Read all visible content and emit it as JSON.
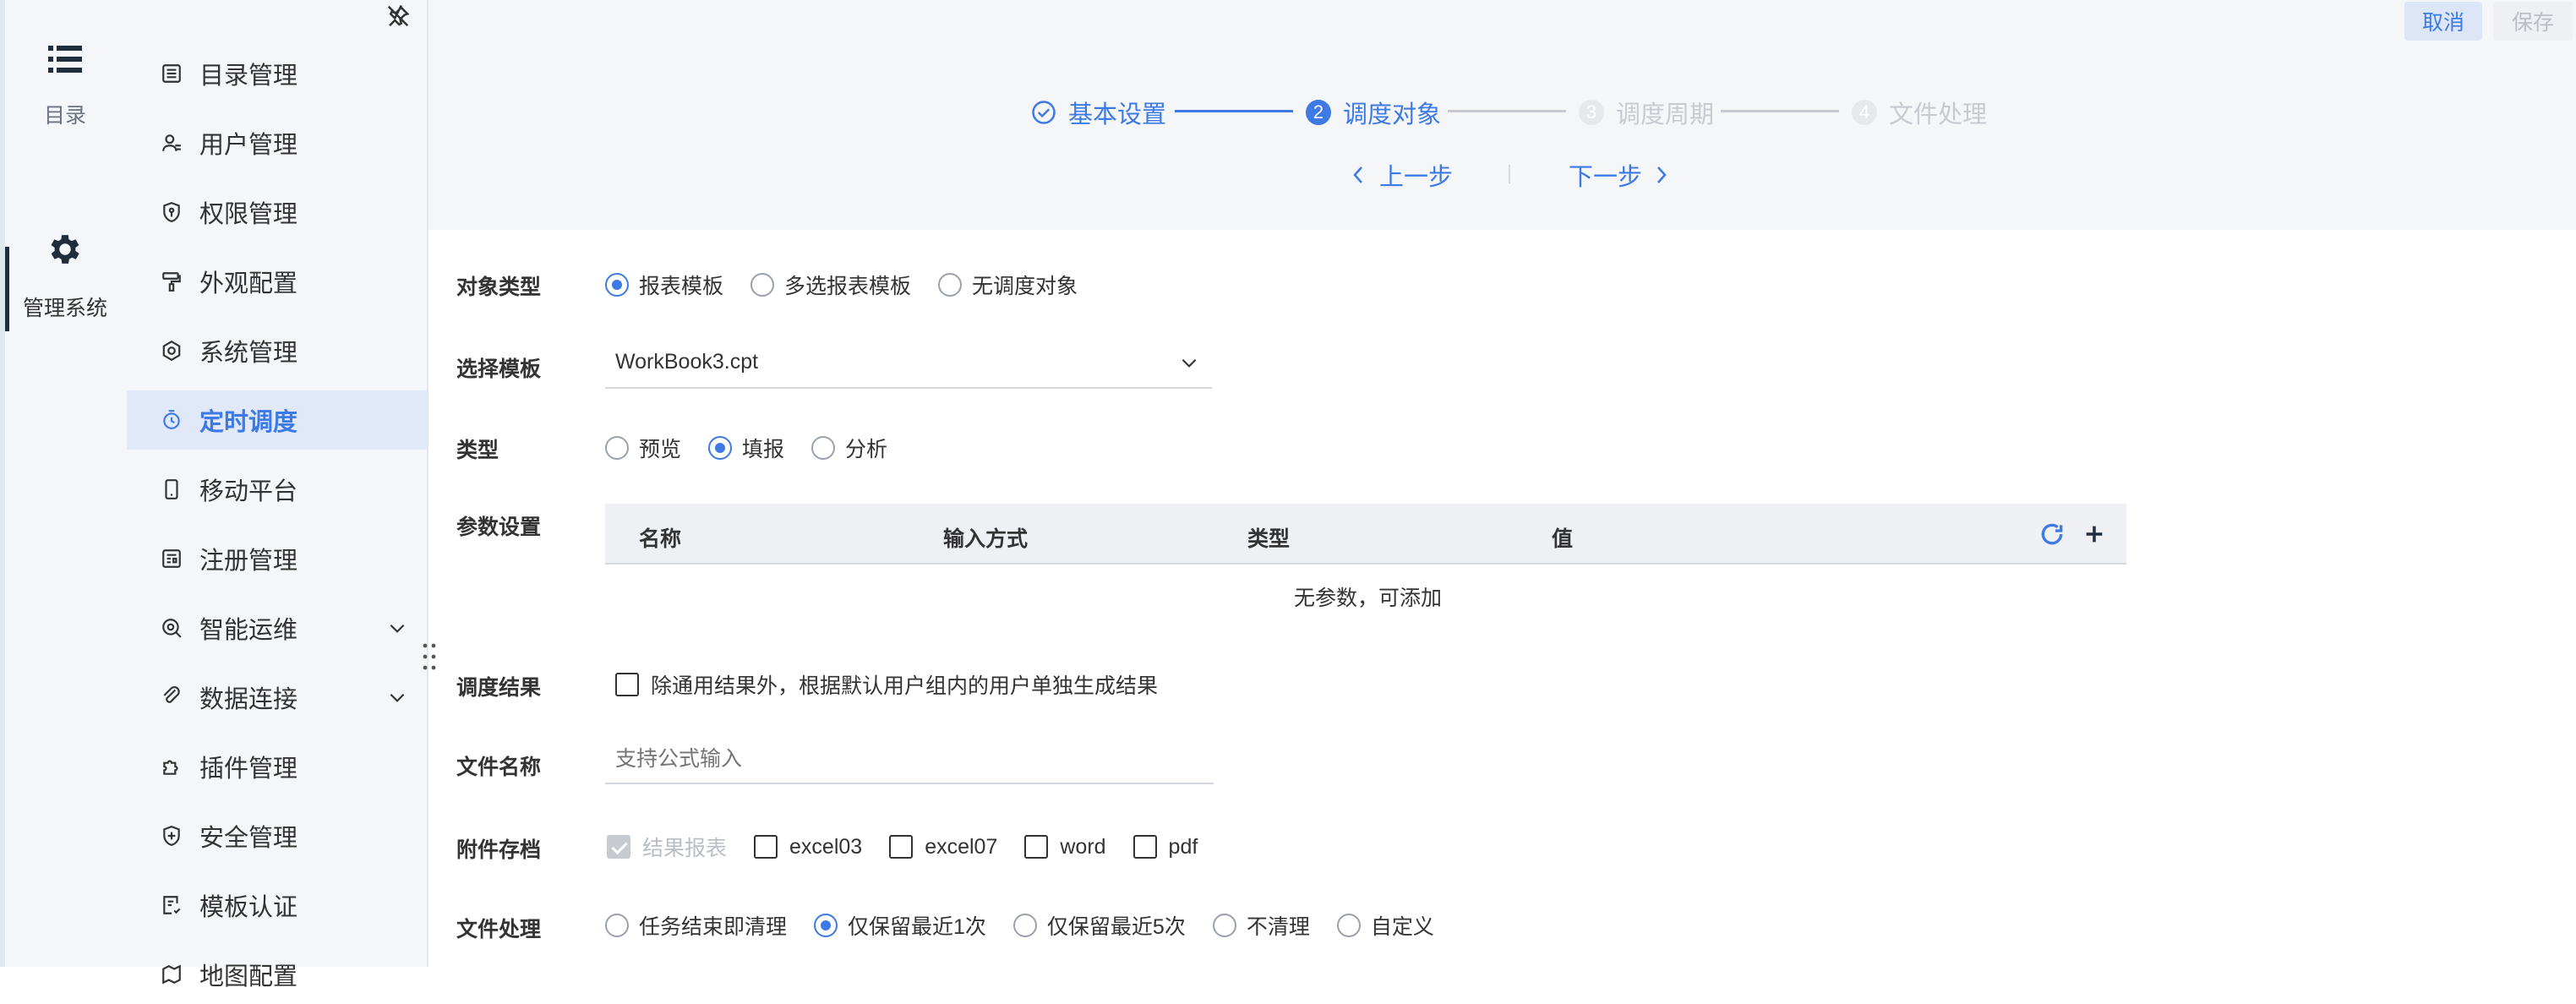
{
  "rail": {
    "items": [
      {
        "label": "目录",
        "icon": "list-icon"
      },
      {
        "label": "管理系统",
        "icon": "gear-icon"
      }
    ]
  },
  "sidebar": {
    "items": [
      {
        "label": "目录管理",
        "icon": "directory-icon"
      },
      {
        "label": "用户管理",
        "icon": "user-icon"
      },
      {
        "label": "权限管理",
        "icon": "permission-shield-icon"
      },
      {
        "label": "外观配置",
        "icon": "paint-roller-icon"
      },
      {
        "label": "系统管理",
        "icon": "settings-icon"
      },
      {
        "label": "定时调度",
        "icon": "timer-icon"
      },
      {
        "label": "移动平台",
        "icon": "mobile-icon"
      },
      {
        "label": "注册管理",
        "icon": "register-icon"
      },
      {
        "label": "智能运维",
        "icon": "ops-icon"
      },
      {
        "label": "数据连接",
        "icon": "link-icon"
      },
      {
        "label": "插件管理",
        "icon": "plugin-icon"
      },
      {
        "label": "安全管理",
        "icon": "security-icon"
      },
      {
        "label": "模板认证",
        "icon": "template-cert-icon"
      },
      {
        "label": "地图配置",
        "icon": "map-icon"
      }
    ],
    "active_index": 5
  },
  "header": {
    "cancel_label": "取消",
    "save_label": "保存",
    "steps": [
      {
        "label": "基本设置",
        "state": "done"
      },
      {
        "num": "2",
        "label": "调度对象",
        "state": "current"
      },
      {
        "num": "3",
        "label": "调度周期",
        "state": "pending"
      },
      {
        "num": "4",
        "label": "文件处理",
        "state": "pending"
      }
    ],
    "prev_label": "上一步",
    "next_label": "下一步"
  },
  "form": {
    "object_type": {
      "label": "对象类型",
      "options": [
        "报表模板",
        "多选报表模板",
        "无调度对象"
      ],
      "selected": 0
    },
    "template": {
      "label": "选择模板",
      "value": "WorkBook3.cpt"
    },
    "type": {
      "label": "类型",
      "options": [
        "预览",
        "填报",
        "分析"
      ],
      "selected": 1
    },
    "params": {
      "label": "参数设置",
      "columns": [
        "名称",
        "输入方式",
        "类型",
        "值"
      ],
      "empty_text": "无参数，可添加"
    },
    "result": {
      "label": "调度结果",
      "checkbox_label": "除通用结果外，根据默认用户组内的用户单独生成结果",
      "checked": false
    },
    "filename": {
      "label": "文件名称",
      "placeholder": "支持公式输入",
      "value": ""
    },
    "attachment": {
      "label": "附件存档",
      "options": [
        "结果报表",
        "excel03",
        "excel07",
        "word",
        "pdf"
      ]
    },
    "file_handling": {
      "label": "文件处理",
      "options": [
        "任务结束即清理",
        "仅保留最近1次",
        "仅保留最近5次",
        "不清理",
        "自定义"
      ],
      "selected": 1
    }
  },
  "colors": {
    "accent": "#3d7ae5",
    "rail_bg": "#f4f6f9",
    "active_bg": "#e1e9f9",
    "pending": "#c7cbd1"
  }
}
